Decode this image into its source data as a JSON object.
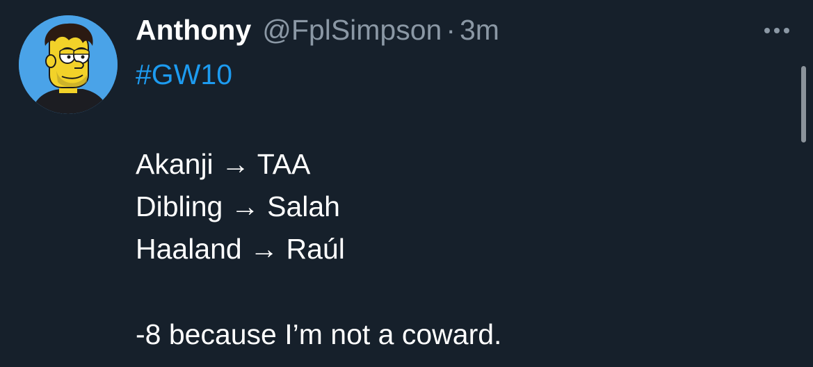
{
  "tweet": {
    "author": {
      "display_name": "Anthony",
      "handle": "@FplSimpson",
      "avatar_icon": "simpsons-style-avatar"
    },
    "separator": "·",
    "timestamp": "3m",
    "hashtag": "#GW10",
    "transfers": [
      "Akanji → TAA",
      "Dibling → Salah",
      "Haaland → Raúl"
    ],
    "closing": "-8 because I’m not a coward.",
    "more_icon": "more-options-icon"
  },
  "colors": {
    "background": "#16202b",
    "text": "#ffffff",
    "secondary_text": "#8b98a5",
    "link": "#1d9bf0"
  }
}
